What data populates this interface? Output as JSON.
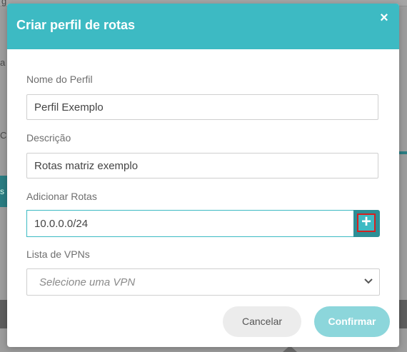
{
  "modal": {
    "title": "Criar perfil de rotas",
    "close_icon": "×",
    "fields": {
      "profile_name": {
        "label": "Nome do Perfil",
        "value": "Perfil Exemplo"
      },
      "description": {
        "label": "Descrição",
        "value": "Rotas matriz exemplo"
      },
      "routes": {
        "label": "Adicionar Rotas",
        "value": "10.0.0.0/24",
        "add_icon": "+"
      },
      "vpn_list": {
        "label": "Lista de VPNs",
        "placeholder": "Selecione uma VPN"
      }
    },
    "buttons": {
      "cancel": "Cancelar",
      "confirm": "Confirmar"
    }
  },
  "background": {
    "fragments": [
      "g",
      "a",
      "C",
      "s"
    ]
  },
  "colors": {
    "header": "#3dbac3",
    "confirm_button": "#8cd6db",
    "add_button": "#2d8f96",
    "highlight_border": "#d71f1f"
  }
}
